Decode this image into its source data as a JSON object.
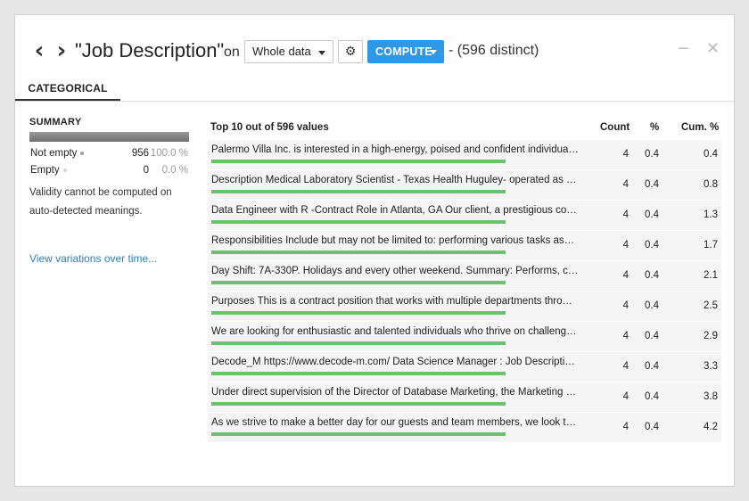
{
  "header": {
    "back_icon": "chevron-left-icon",
    "forward_icon": "chevron-right-icon",
    "column_title": "\"Job Description\"",
    "on_word": "on",
    "sample_select": "Whole data",
    "compute_label": "COMPUTE",
    "distinct_label": "- (596 distinct)",
    "minimize_icon": "minus-icon",
    "close_icon": "close-icon"
  },
  "tabs": [
    {
      "label": "CATEGORICAL"
    }
  ],
  "summary": {
    "title": "SUMMARY",
    "rows": [
      {
        "label": "Not empty",
        "count": "956",
        "pct": "100.0 %",
        "dot_color": "#9e9e9e"
      },
      {
        "label": "Empty",
        "count": "0",
        "pct": "0.0 %",
        "dot_color": "#d6d6d6"
      }
    ],
    "note": "Validity cannot be computed on auto-detected meanings.",
    "variations_link": "View variations over time..."
  },
  "table": {
    "title": "Top 10 out of 596 values",
    "col_count": "Count",
    "col_pct": "%",
    "col_cum": "Cum. %",
    "bar_color": "#6cc070",
    "rows": [
      {
        "value": "Palermo Villa Inc. is interested in a high-energy, poised and confident individual…",
        "count": "4",
        "pct": "0.4",
        "cum": "0.4"
      },
      {
        "value": "Description Medical Laboratory Scientist - Texas Health Huguley- operated as jo…",
        "count": "4",
        "pct": "0.4",
        "cum": "0.8"
      },
      {
        "value": "Data Engineer with R -Contract Role in Atlanta, GA Our client, a prestigious cons…",
        "count": "4",
        "pct": "0.4",
        "cum": "1.3"
      },
      {
        "value": "Responsibilities Include but may not be limited to: performing various tasks ass…",
        "count": "4",
        "pct": "0.4",
        "cum": "1.7"
      },
      {
        "value": "Day Shift: 7A-330P. Holidays and every other weekend. Summary: Performs, cal…",
        "count": "4",
        "pct": "0.4",
        "cum": "2.1"
      },
      {
        "value": "Purposes This is a contract position that works with multiple departments thro…",
        "count": "4",
        "pct": "0.4",
        "cum": "2.5"
      },
      {
        "value": "We are looking for enthusiastic and talented individuals who thrive on challeng…",
        "count": "4",
        "pct": "0.4",
        "cum": "2.9"
      },
      {
        "value": "Decode_M https://www.decode-m.com/ Data Science Manager : Job Descriptio…",
        "count": "4",
        "pct": "0.4",
        "cum": "3.3"
      },
      {
        "value": "Under direct supervision of the Director of Database Marketing, the Marketing D…",
        "count": "4",
        "pct": "0.4",
        "cum": "3.8"
      },
      {
        "value": "As we strive to make a better day for our guests and team members, we look to …",
        "count": "4",
        "pct": "0.4",
        "cum": "4.2"
      }
    ]
  }
}
